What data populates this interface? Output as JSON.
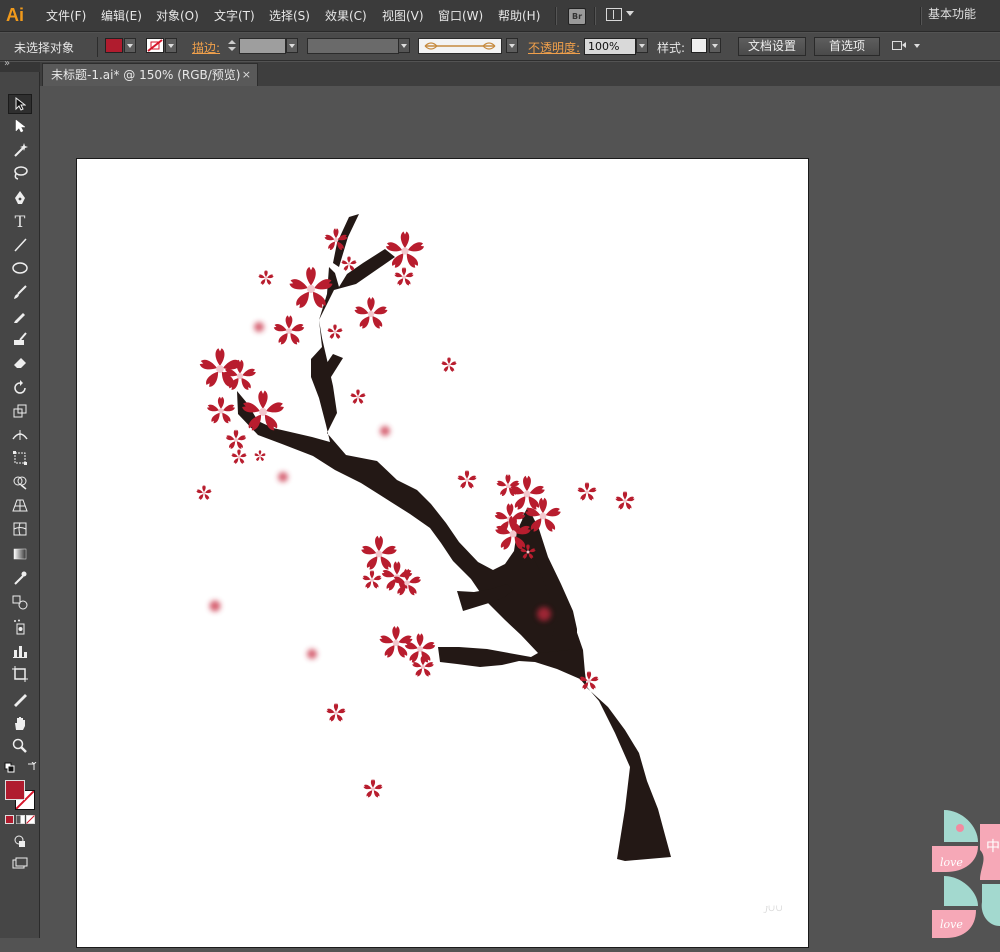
{
  "app": {
    "logo": "Ai"
  },
  "menu": [
    "文件(F)",
    "编辑(E)",
    "对象(O)",
    "文字(T)",
    "选择(S)",
    "效果(C)",
    "视图(V)",
    "窗口(W)",
    "帮助(H)"
  ],
  "bridge_label": "Br",
  "workspace_label": "基本功能",
  "control": {
    "selection_status": "未选择对象",
    "stroke_label": "描边:",
    "opacity_label": "不透明度:",
    "opacity_value": "100%",
    "style_label": "样式:",
    "doc_setup_button": "文档设置",
    "preferences_button": "首选项"
  },
  "document_tab": {
    "title": "未标题-1.ai* @ 150% (RGB/预览)",
    "close": "×"
  },
  "tools": [
    "selection-tool",
    "direct-selection-tool",
    "magic-wand-tool",
    "lasso-tool",
    "pen-tool",
    "type-tool",
    "line-tool",
    "ellipse-tool",
    "paintbrush-tool",
    "pencil-tool",
    "blob-brush-tool",
    "eraser-tool",
    "rotate-tool",
    "scale-tool",
    "width-tool",
    "free-transform-tool",
    "shape-builder-tool",
    "perspective-grid-tool",
    "mesh-tool",
    "gradient-tool",
    "eyedropper-tool",
    "blend-tool",
    "symbol-sprayer-tool",
    "column-graph-tool",
    "artboard-tool",
    "slice-tool",
    "hand-tool",
    "zoom-tool"
  ],
  "type_tool_glyph": "T",
  "colors": {
    "fill": "#b01c2e",
    "blossom": "#b81d2e",
    "branch": "#231815",
    "accent": "#f19a1b"
  },
  "watermark": {
    "text_1": "中",
    "text_2": "love"
  }
}
